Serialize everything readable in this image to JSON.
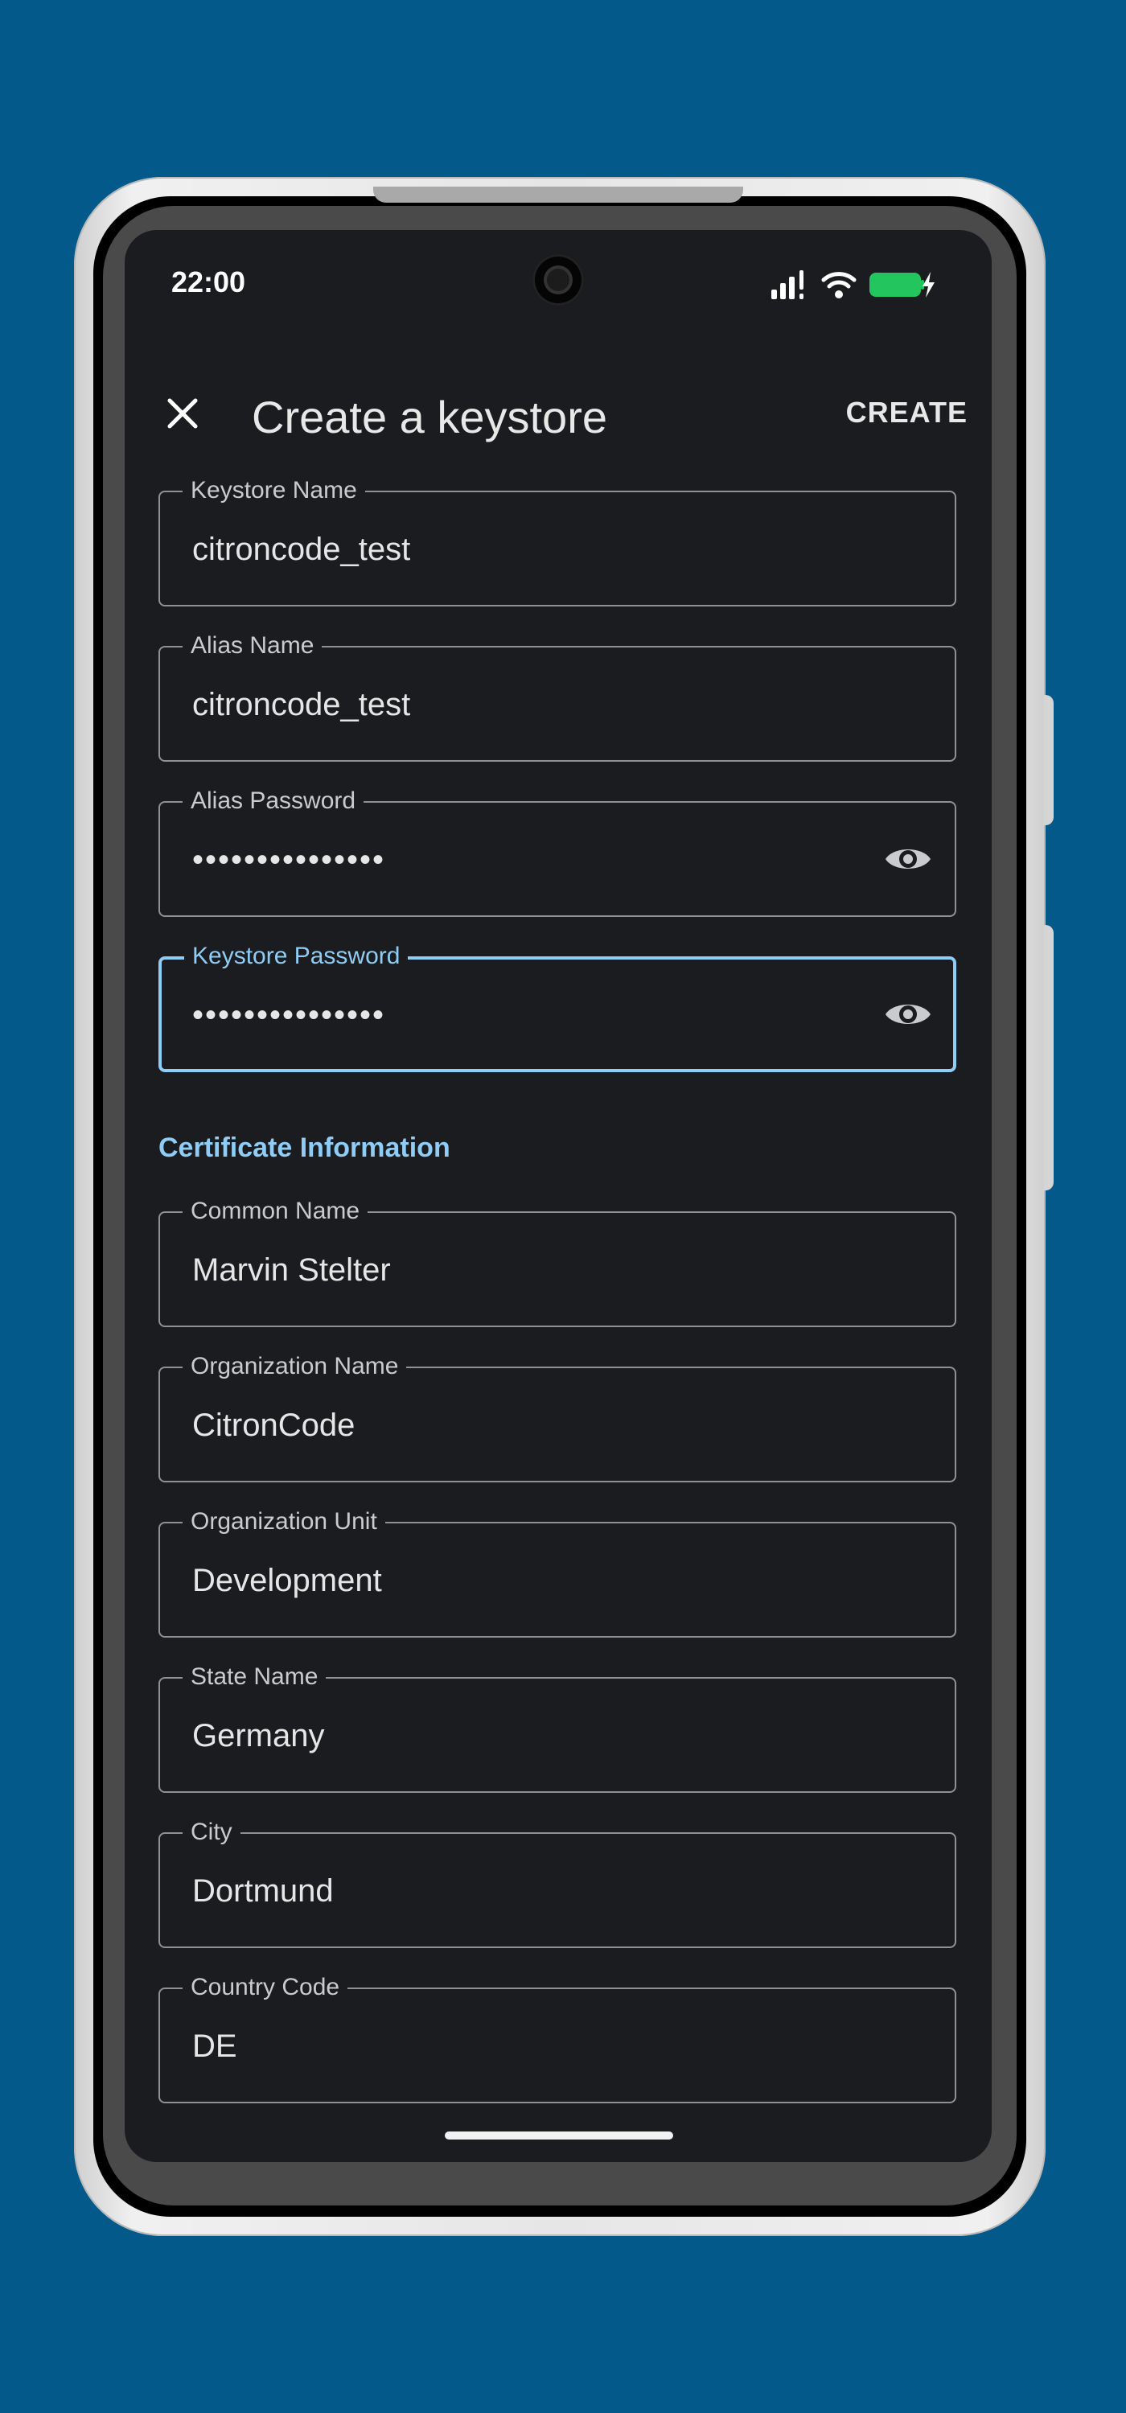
{
  "status_bar": {
    "time": "22:00"
  },
  "app_bar": {
    "title": "Create a keystore",
    "create_label": "CREATE"
  },
  "fields": {
    "keystore_name": {
      "label": "Keystore Name",
      "value": "citroncode_test"
    },
    "alias_name": {
      "label": "Alias Name",
      "value": "citroncode_test"
    },
    "alias_password": {
      "label": "Alias Password",
      "value": "•••••••••••••••"
    },
    "keystore_password": {
      "label": "Keystore Password",
      "value": "•••••••••••••••"
    }
  },
  "certificate": {
    "section_title": "Certificate Information",
    "common_name": {
      "label": "Common Name",
      "value": "Marvin Stelter"
    },
    "organization_name": {
      "label": "Organization Name",
      "value": "CitronCode"
    },
    "organization_unit": {
      "label": "Organization Unit",
      "value": "Development"
    },
    "state_name": {
      "label": "State Name",
      "value": "Germany"
    },
    "city": {
      "label": "City",
      "value": "Dortmund"
    },
    "country_code": {
      "label": "Country Code",
      "value": "DE"
    }
  },
  "colors": {
    "background": "#035a8a",
    "screen": "#1a1c1f",
    "accent": "#8fcdf6",
    "outline": "#8e9196",
    "battery": "#22c55e"
  },
  "icons": {
    "close": "close-icon",
    "visibility": "eye-icon",
    "signal": "signal-icon",
    "wifi": "wifi-icon",
    "battery": "battery-charging-icon"
  }
}
